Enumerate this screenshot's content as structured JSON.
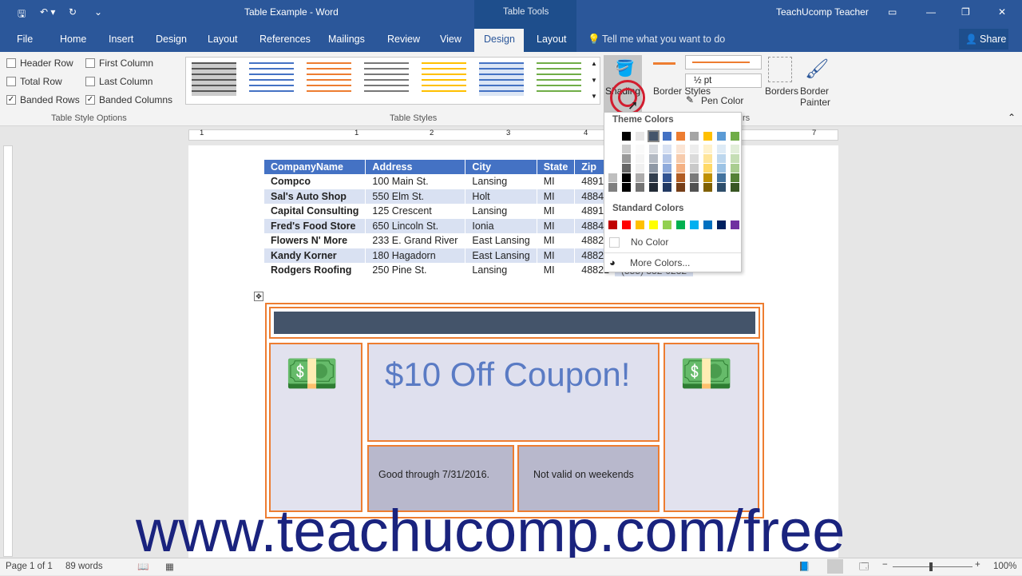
{
  "window": {
    "title": "Table Example - Word",
    "context_tab": "Table Tools",
    "user": "TeachUcomp Teacher"
  },
  "tabs": [
    "File",
    "Home",
    "Insert",
    "Design",
    "Layout",
    "References",
    "Mailings",
    "Review",
    "View",
    "Design",
    "Layout"
  ],
  "tell_me": "Tell me what you want to do",
  "share": "Share",
  "style_options": {
    "header_row": "Header Row",
    "total_row": "Total Row",
    "banded_rows": "Banded Rows",
    "first_column": "First Column",
    "last_column": "Last Column",
    "banded_columns": "Banded Columns",
    "group_label": "Table Style Options"
  },
  "table_styles_label": "Table Styles",
  "ribbon": {
    "shading": "Shading",
    "border_styles": "Border Styles",
    "pen_weight": "½ pt",
    "pen_color": "Pen Color",
    "borders": "Borders",
    "border_painter": "Border Painter",
    "borders_group_partial": "rs"
  },
  "ruler_numbers": [
    "1",
    "1",
    "2",
    "3",
    "4",
    "7"
  ],
  "table": {
    "headers": [
      "CompanyName",
      "Address",
      "City",
      "State",
      "Zip"
    ],
    "rows": [
      [
        "Compco",
        "100 Main St.",
        "Lansing",
        "MI",
        "48912"
      ],
      [
        "Sal's Auto Shop",
        "550 Elm St.",
        "Holt",
        "MI",
        "48842"
      ],
      [
        "Capital Consulting",
        "125 Crescent",
        "Lansing",
        "MI",
        "48912"
      ],
      [
        "Fred's Food Store",
        "650 Lincoln St.",
        "Ionia",
        "MI",
        "48846"
      ],
      [
        "Flowers N' More",
        "233 E. Grand River",
        "East Lansing",
        "MI",
        "48823"
      ],
      [
        "Kandy Korner",
        "180 Hagadorn",
        "East Lansing",
        "MI",
        "48823"
      ],
      [
        "Rodgers Roofing",
        "250 Pine St.",
        "Lansing",
        "MI",
        "48821"
      ]
    ],
    "partial_phone": "(555) 332-0232"
  },
  "coupon": {
    "title": "$10 Off Coupon!",
    "good_through": "Good through 7/31/2016.",
    "not_valid": "Not valid on weekends"
  },
  "dropdown": {
    "theme_colors": "Theme Colors",
    "standard_colors": "Standard Colors",
    "no_color": "No Color",
    "more_colors": "More Colors..."
  },
  "status": {
    "page": "Page 1 of 1",
    "words": "89 words",
    "zoom": "100%"
  },
  "watermark": "www.teachucomp.com/free",
  "colors": {
    "accent": "#2b579a",
    "orange": "#ed7d31",
    "header_blue": "#4472c4"
  }
}
